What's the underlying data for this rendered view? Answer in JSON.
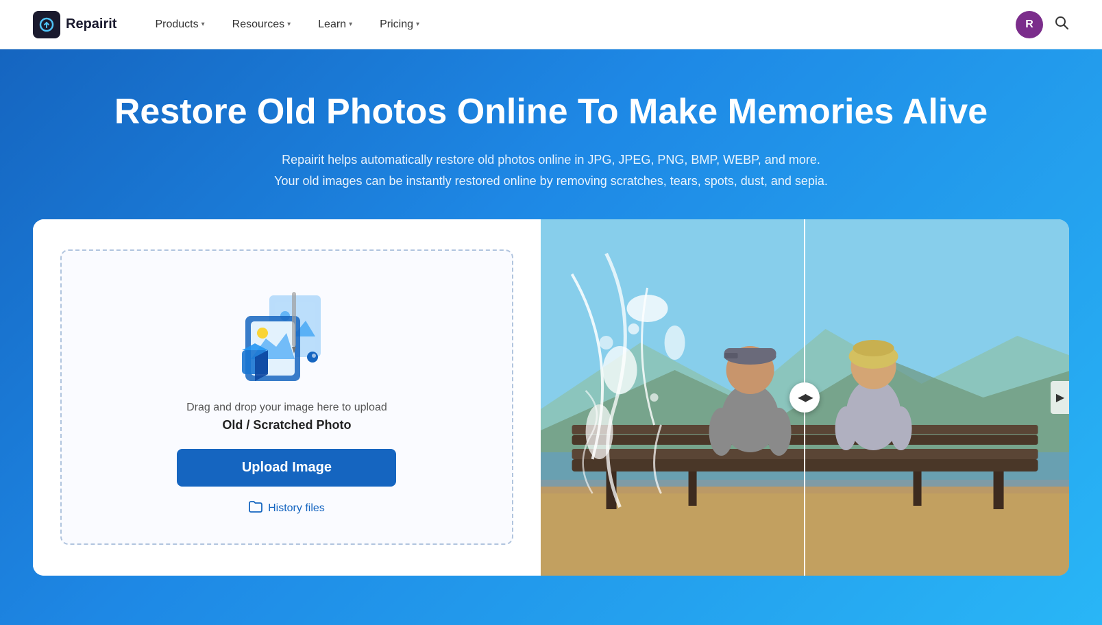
{
  "navbar": {
    "logo_text": "Repairit",
    "avatar_letter": "R",
    "links": [
      {
        "label": "Products",
        "has_chevron": true
      },
      {
        "label": "Resources",
        "has_chevron": true
      },
      {
        "label": "Learn",
        "has_chevron": true
      },
      {
        "label": "Pricing",
        "has_chevron": true
      }
    ]
  },
  "hero": {
    "title": "Restore Old Photos Online To Make Memories Alive",
    "subtitle_line1": "Repairit helps automatically restore old photos online in JPG, JPEG, PNG, BMP, WEBP, and more.",
    "subtitle_line2": "Your old images can be instantly restored online by removing scratches, tears, spots, dust, and sepia."
  },
  "upload": {
    "drag_text": "Drag and drop your image here to upload",
    "type_label": "Old / Scratched Photo",
    "button_label": "Upload Image",
    "history_label": "History files"
  },
  "colors": {
    "primary": "#1565c0",
    "hero_gradient_start": "#1565c0",
    "hero_gradient_end": "#29b6f6",
    "avatar_bg": "#7b2d8b"
  }
}
